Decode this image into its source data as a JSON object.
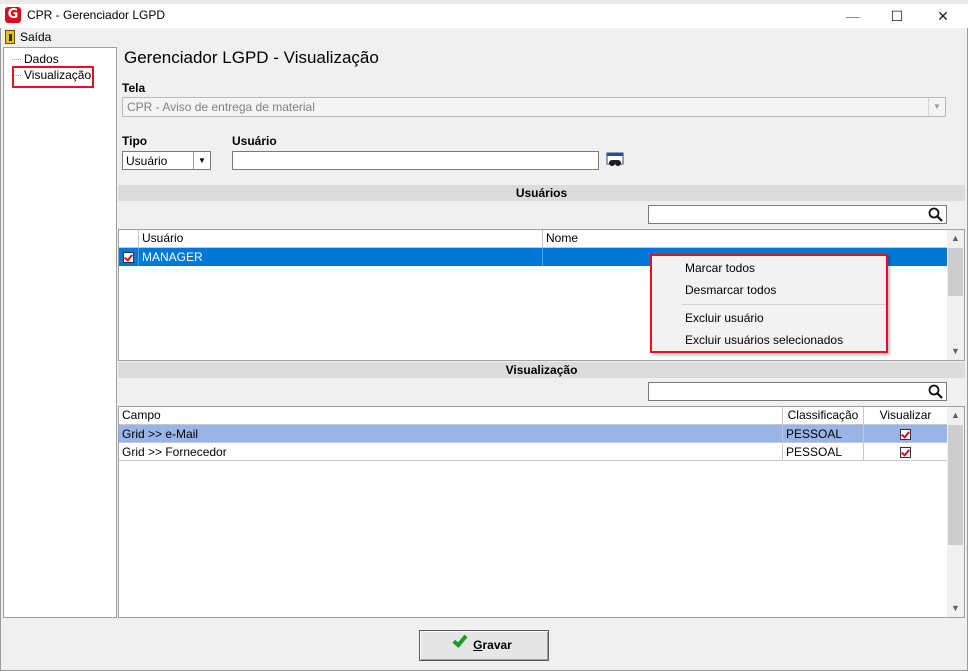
{
  "window": {
    "title": "CPR - Gerenciador LGPD",
    "logo_letter": "G",
    "minimize_glyph": "—",
    "maximize_glyph": "☐",
    "close_glyph": "✕"
  },
  "menu": {
    "exit_label": "Saída"
  },
  "tree": {
    "items": [
      "Dados",
      "Visualização"
    ],
    "selected": "Visualização"
  },
  "page": {
    "title": "Gerenciador LGPD - Visualização"
  },
  "form": {
    "tela_label": "Tela",
    "tela_value": "CPR - Aviso de entrega de material",
    "tipo_label": "Tipo",
    "tipo_value": "Usuário",
    "usuario_label": "Usuário",
    "usuario_value": "",
    "dropdown_glyph": "▼"
  },
  "usuarios": {
    "section_title": "Usuários",
    "search_value": "",
    "columns": [
      "Usuário",
      "Nome"
    ],
    "rows": [
      {
        "checked": true,
        "usuario": "MANAGER",
        "nome": ""
      }
    ]
  },
  "context_menu": {
    "items": [
      "Marcar todos",
      "Desmarcar todos",
      "Excluir usuário",
      "Excluir usuários selecionados"
    ]
  },
  "visualizacao": {
    "section_title": "Visualização",
    "search_value": "",
    "columns": [
      "Campo",
      "Classificação",
      "Visualizar"
    ],
    "rows": [
      {
        "campo": "Grid >> e-Mail",
        "classificacao": "PESSOAL",
        "visualizar": true,
        "selected": true
      },
      {
        "campo": "Grid >> Fornecedor",
        "classificacao": "PESSOAL",
        "visualizar": true,
        "selected": false
      }
    ]
  },
  "scroll": {
    "up_glyph": "▲",
    "down_glyph": "▼"
  },
  "footer": {
    "save_label_u": "G",
    "save_label_rest": "ravar"
  },
  "colors": {
    "selection_blue": "#0078d7",
    "row_selected": "#99b4e6",
    "highlight_red": "#e0141e",
    "check_green": "#1a9c2a",
    "brand_red": "#d4101a"
  }
}
